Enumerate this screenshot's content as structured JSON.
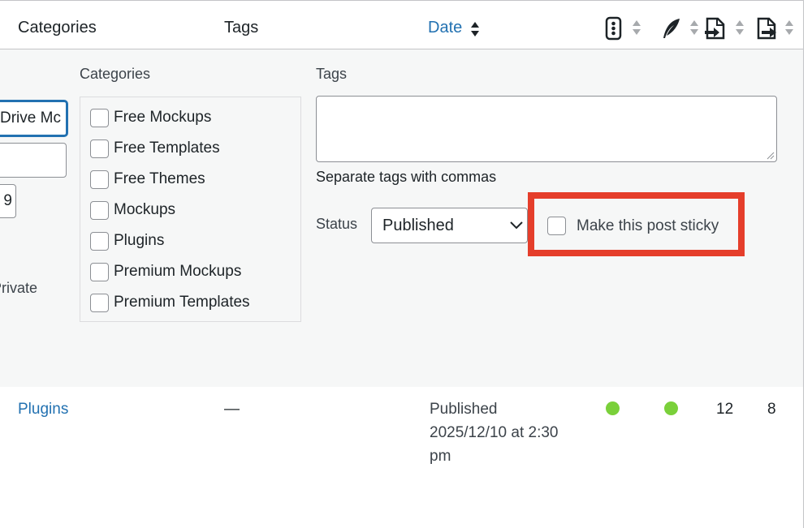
{
  "table_header": {
    "categories": "Categories",
    "tags": "Tags",
    "date": "Date",
    "column_icons": [
      "traffic-light-icon",
      "feather-icon",
      "incoming-links-icon",
      "outgoing-links-icon"
    ]
  },
  "quick_edit": {
    "title_value": "Drive Mc",
    "slug_value": "",
    "date_fragment": "9",
    "private_label": "Private",
    "categories_label": "Categories",
    "categories": [
      {
        "label": "Free Mockups",
        "checked": false
      },
      {
        "label": "Free Templates",
        "checked": false
      },
      {
        "label": "Free Themes",
        "checked": false
      },
      {
        "label": "Mockups",
        "checked": false
      },
      {
        "label": "Plugins",
        "checked": false
      },
      {
        "label": "Premium Mockups",
        "checked": false
      },
      {
        "label": "Premium Templates",
        "checked": false
      }
    ],
    "tags_label": "Tags",
    "tags_value": "",
    "tags_help": "Separate tags with commas",
    "status_label": "Status",
    "status_value": "Published",
    "sticky_label": "Make this post sticky",
    "sticky_checked": false
  },
  "post_row": {
    "category": "Plugins",
    "tags": "—",
    "date_line1": "Published",
    "date_line2": "2025/12/10 at 2:30",
    "date_line3": "pm",
    "seo_status": "good",
    "readability_status": "good",
    "incoming_links": "12",
    "outgoing_links": "8"
  },
  "colors": {
    "link": "#2271b1",
    "highlight": "#e53e2b",
    "status_good": "#7ad03a",
    "panel_bg": "#f6f7f7"
  }
}
